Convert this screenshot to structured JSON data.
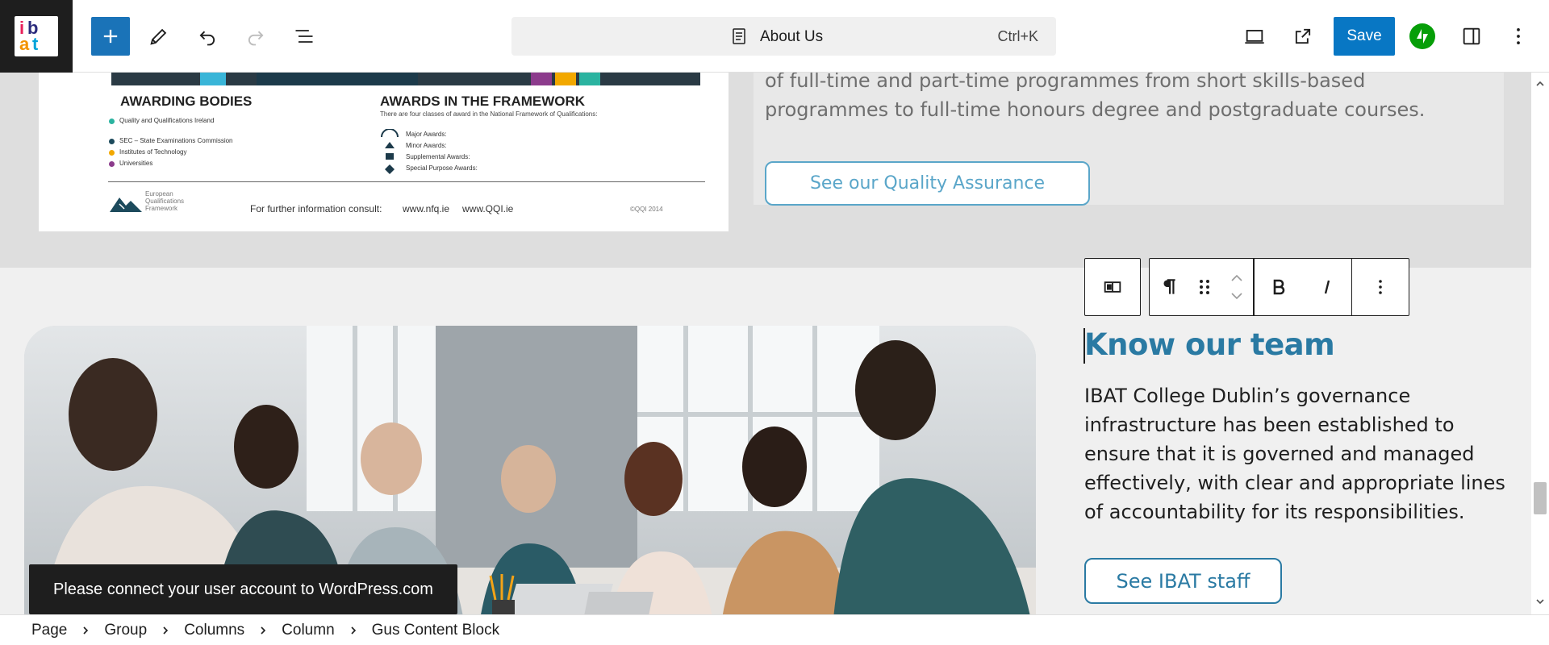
{
  "toolbar": {
    "document_title": "About Us",
    "shortcut": "Ctrl+K",
    "save_label": "Save",
    "logo_text": "ibat"
  },
  "framework_image": {
    "heading_left": "AWARDING BODIES",
    "heading_right": "AWARDS IN THE FRAMEWORK",
    "right_sub": "There are four classes of award in the National Framework of Qualifications:",
    "bodies": [
      {
        "name": "Quality and Qualifications Ireland",
        "color": "#2bb3a0"
      },
      {
        "name": "SEC – State Examinations Commission",
        "color": "#1c4a5c"
      },
      {
        "name": "Institutes of Technology",
        "color": "#f2a800"
      },
      {
        "name": "Universities",
        "color": "#8c3b8c"
      }
    ],
    "awards": [
      "Major Awards:",
      "Minor Awards:",
      "Supplemental Awards:",
      "Special Purpose Awards:"
    ],
    "footer_label": "For further information consult:",
    "footer_links": [
      "www.nfq.ie",
      "www.QQI.ie"
    ],
    "footer_year": "©QQI 2014",
    "logo_caption": "European Qualifications Framework"
  },
  "quality_card": {
    "text": "of full-time and part-time programmes from short skills-based programmes to full-time honours degree and postgraduate courses.",
    "button": "See our Quality Assurance"
  },
  "team_block": {
    "heading": "Know our team",
    "body": "IBAT College Dublin’s governance infrastructure has been established to ensure that it is governed and managed effectively, with clear and appropriate lines of accountability for its responsibilities.",
    "button": "See IBAT staff"
  },
  "snackbar": {
    "message": "Please connect your user account to WordPress.com"
  },
  "breadcrumbs": [
    "Page",
    "Group",
    "Columns",
    "Column",
    "Gus Content Block"
  ],
  "colors": {
    "accent_blue": "#0877c4",
    "heading_blue": "#2a7aa3",
    "jetpack_green": "#069e08"
  }
}
